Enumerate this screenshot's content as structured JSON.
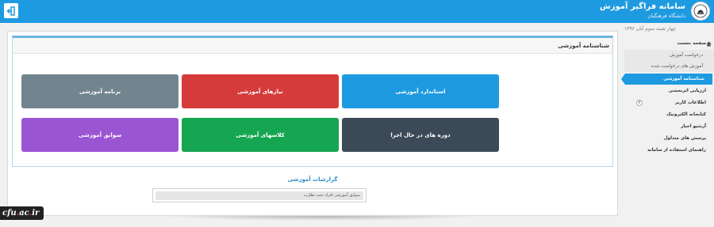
{
  "header": {
    "title": "سامانه فراگیر آموزش",
    "subtitle": "دانشگاه فرهنگیان",
    "logo_icon": "university-seal-icon",
    "logout_icon": "logout-icon",
    "color": "#1e9ae0"
  },
  "date": "چهار شنبه سوم آبان ۱۳۹۶",
  "sidebar": {
    "items": [
      {
        "label": "صفحه نخست",
        "icon": "home-icon"
      },
      {
        "label": "درخواست آموزش"
      },
      {
        "label": "آموزش های درخواست شده"
      },
      {
        "label": "شناسنامه آموزشی"
      },
      {
        "label": "ارزیابی اثربخشی"
      },
      {
        "label": "اطلاعات کاربر",
        "badge": "۲"
      },
      {
        "label": "کتابخانه الکترونیک"
      },
      {
        "label": "آرشیو اخبار"
      },
      {
        "label": "پرسش های متداول"
      },
      {
        "label": "راهنمای استفاده از سامانه"
      }
    ]
  },
  "main": {
    "section_title": "شناسنامه آموزشی",
    "tiles": [
      {
        "label": "استاندارد آموزشی",
        "color": "#1e9ae0"
      },
      {
        "label": "نیازهای آموزشی",
        "color": "#d63b3b"
      },
      {
        "label": "برنامه آموزشی",
        "color": "#72858f"
      },
      {
        "label": "دوره های در حال اجرا",
        "color": "#3c4a57"
      },
      {
        "label": "کلاسهای آموزشی",
        "color": "#16a550"
      },
      {
        "label": "سوابق آموزشی",
        "color": "#9a55d3"
      }
    ],
    "reports": {
      "title": "گزارشات آموزشی",
      "items": [
        "سوابق آموزشی افراد تحت نظارت"
      ]
    }
  },
  "watermark": {
    "prefix": "cfu",
    "dot1": ".",
    "mid": "ac",
    "dot2": ".",
    "suffix": "ir"
  }
}
